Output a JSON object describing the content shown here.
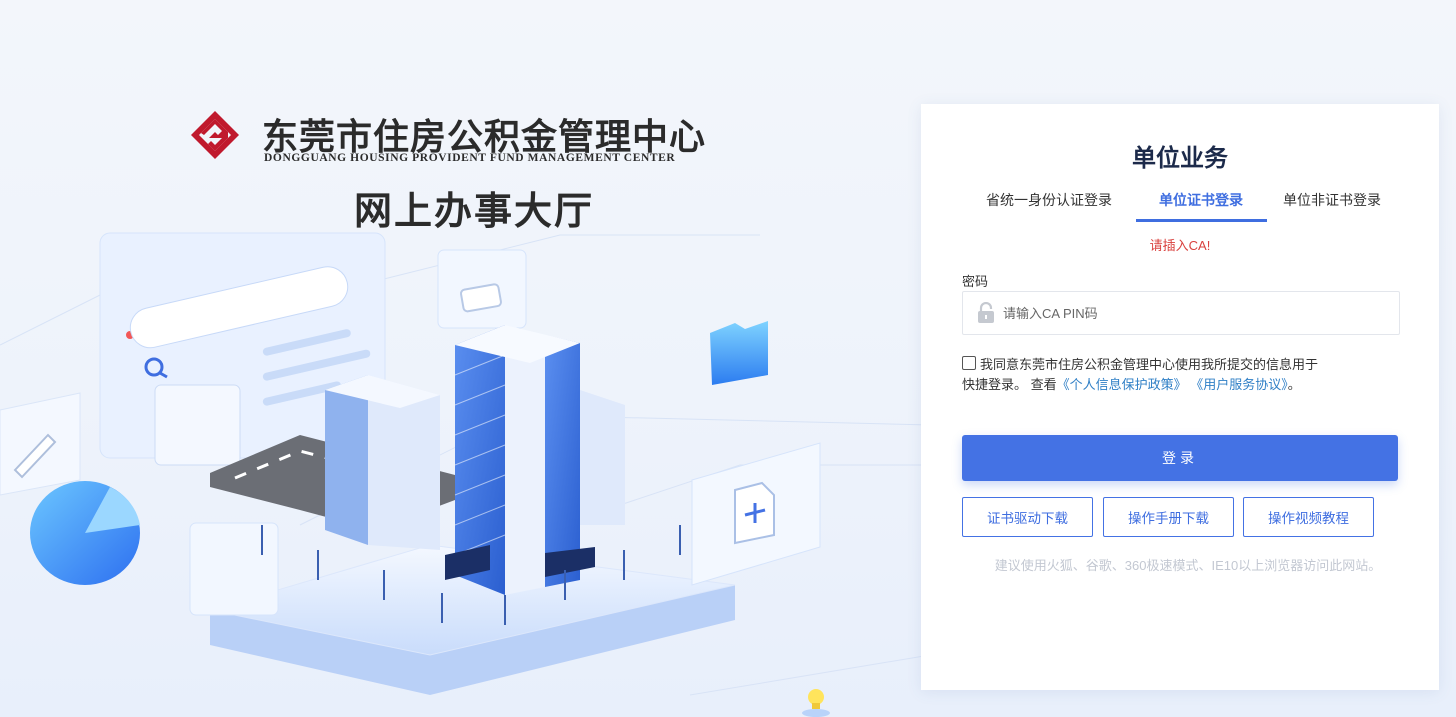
{
  "brand": {
    "name_cn": "东莞市住房公积金管理中心",
    "name_en": "DONGGUANG HOUSING PROVIDENT FUND MANAGEMENT CENTER",
    "hall_title": "网上办事大厅"
  },
  "colors": {
    "accent": "#4472e4",
    "brand_red": "#c0192d",
    "warning": "#d9413e",
    "link": "#2f7fc6"
  },
  "login": {
    "title": "单位业务",
    "tabs": [
      {
        "label": "省统一身份认证登录",
        "active": false
      },
      {
        "label": "单位证书登录",
        "active": true
      },
      {
        "label": "单位非证书登录",
        "active": false
      }
    ],
    "ca_warning": "请插入CA!",
    "password_label": "密码",
    "password_placeholder": "请输入CA PIN码",
    "password_value": "",
    "password_icon": "lock-icon",
    "agreement": {
      "checked": false,
      "text_line1": "我同意东莞市住房公积金管理中心使用我所提交的信息用于",
      "text_line2": "快捷登录。 查看",
      "privacy_link": "《个人信息保护政策》",
      "service_link": "《用户服务协议》",
      "tail": "。"
    },
    "login_button": "登录",
    "links": [
      "证书驱动下载",
      "操作手册下载",
      "操作视频教程"
    ],
    "browser_tip": "建议使用火狐、谷歌、360极速模式、IE10以上浏览器访问此网站。"
  }
}
